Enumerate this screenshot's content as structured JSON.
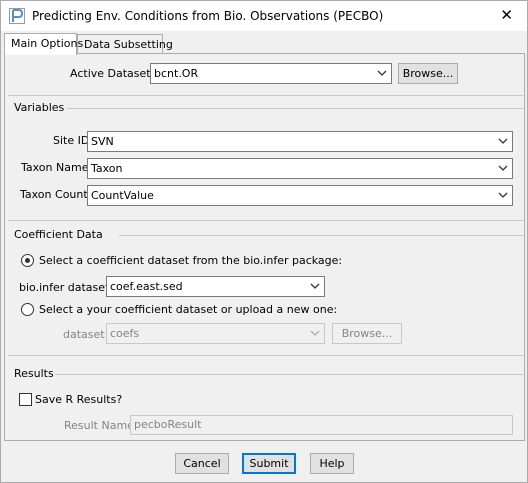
{
  "window": {
    "title": "Predicting Env. Conditions from Bio. Observations (PECBO)"
  },
  "tabs": [
    {
      "label": "Main Options",
      "active": true
    },
    {
      "label": "Data Subsetting",
      "active": false
    }
  ],
  "dataset": {
    "label": "Active Dataset:",
    "value": "bcnt.OR",
    "browse": "Browse..."
  },
  "variables": {
    "title": "Variables",
    "site_id": {
      "label": "Site ID:",
      "value": "SVN"
    },
    "taxon_name": {
      "label": "Taxon Name:",
      "value": "Taxon"
    },
    "taxon_count": {
      "label": "Taxon Count:",
      "value": "CountValue"
    }
  },
  "coefficient": {
    "title": "Coefficient Data",
    "option1": {
      "label": "Select a coefficient dataset from the bio.infer package:",
      "selected": true
    },
    "bioinfer": {
      "label": "bio.infer dataset:",
      "value": "coef.east.sed"
    },
    "option2": {
      "label": "Select a your coefficient dataset or upload a new one:",
      "selected": false
    },
    "dataset": {
      "label": "dataset:",
      "value": "coefs",
      "browse": "Browse..."
    }
  },
  "results": {
    "title": "Results",
    "save_label": "Save R Results?",
    "save_checked": false,
    "result_name_label": "Result Name:",
    "result_name_value": "pecboResult"
  },
  "buttons": {
    "cancel": "Cancel",
    "submit": "Submit",
    "help": "Help"
  }
}
